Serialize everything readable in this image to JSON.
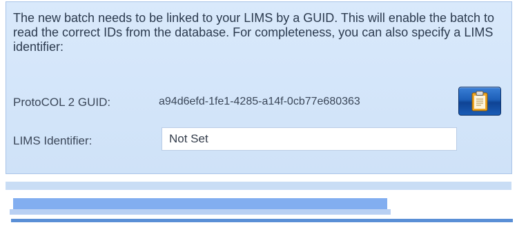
{
  "dialog": {
    "message": "The new batch needs to be linked to your LIMS by a GUID. This will enable the batch to read the correct IDs from the database. For completeness, you can also specify a LIMS identifier:",
    "guid_label": "ProtoCOL 2 GUID:",
    "guid_value": "a94d6efd-1fe1-4285-a14f-0cb77e680363",
    "lims_label": "LIMS Identifier:",
    "lims_value": "Not Set",
    "copy_button_icon": "clipboard-icon"
  },
  "progress": {
    "fraction": 0.75
  },
  "colors": {
    "panel_bg": "#d9e9fb",
    "button_blue": "#1d5fb8",
    "progress_fill": "#82aef0"
  }
}
